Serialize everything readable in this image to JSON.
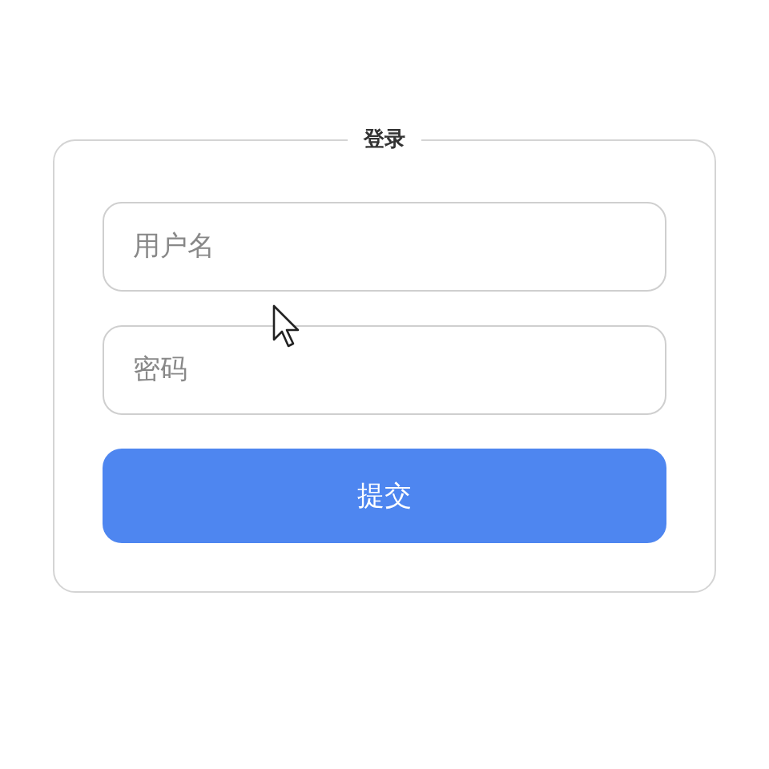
{
  "form": {
    "legend": "登录",
    "fields": [
      {
        "placeholder": "用户名"
      },
      {
        "placeholder": "密码"
      }
    ],
    "submit": "提交"
  }
}
